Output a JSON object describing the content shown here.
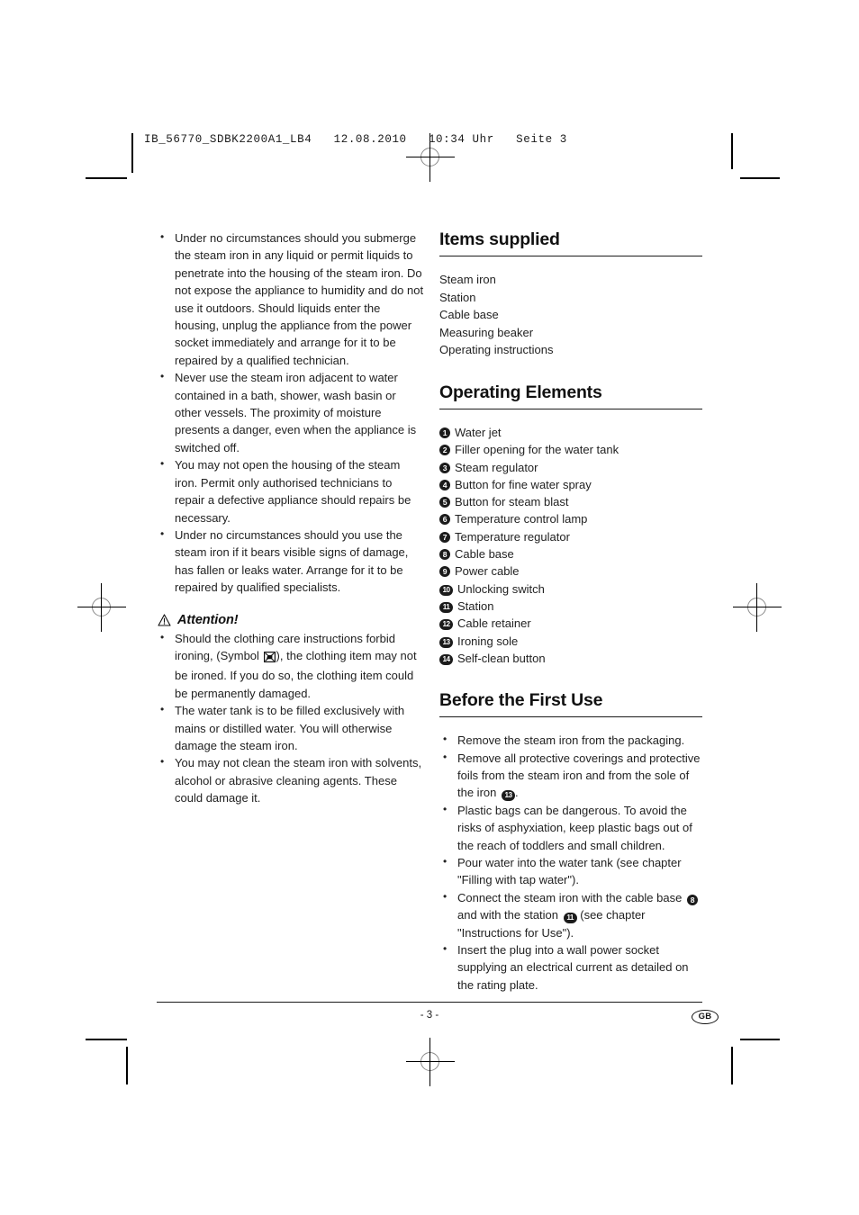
{
  "header": {
    "line": "IB_56770_SDBK2200A1_LB4   12.08.2010   10:34 Uhr   Seite 3"
  },
  "left_column": {
    "safety_bullets": [
      "Under no circumstances should you submerge the steam iron in any liquid or permit liquids to penetrate into the housing of the steam iron. Do not expose the appliance to humidity and do not use it outdoors. Should liquids enter the housing, unplug the appliance from the power socket immediately and arrange for it to be repaired by a qualified technician.",
      "Never use the steam iron adjacent to water contained in a bath, shower, wash basin or other vessels. The proximity of moisture presents a danger, even when the appliance is switched off.",
      "You may not open the housing of the steam iron. Permit only authorised technicians to repair a defective appliance should repairs be necessary.",
      "Under no circumstances should you use the steam iron if it bears visible signs of damage, has fallen or leaks water. Arrange for it to be repaired by qualified specialists."
    ],
    "attention": {
      "icon": "warning-triangle-icon",
      "title": "Attention!",
      "bullet_1_part_1": "Should the clothing care instructions  forbid ironing, (Symbol ",
      "bullet_1_symbol": "do-not-iron-icon",
      "bullet_1_part_2": "), the clothing item may not be ironed. If you do so, the clothing item could be permanently damaged.",
      "bullets": [
        "The water tank is to be filled exclusively with mains or distilled water. You will otherwise damage the steam iron.",
        "You may not clean the steam iron with solvents, alcohol or abrasive cleaning agents. These could damage it."
      ]
    }
  },
  "right_column": {
    "items_supplied": {
      "heading": "Items supplied",
      "items": [
        "Steam iron",
        "Station",
        "Cable base",
        "Measuring beaker",
        "Operating instructions"
      ]
    },
    "operating_elements": {
      "heading": "Operating Elements",
      "items": [
        {
          "num": "1",
          "label": "Water jet"
        },
        {
          "num": "2",
          "label": "Filler opening for the water tank"
        },
        {
          "num": "3",
          "label": "Steam regulator"
        },
        {
          "num": "4",
          "label": "Button for fine water spray"
        },
        {
          "num": "5",
          "label": "Button for steam blast"
        },
        {
          "num": "6",
          "label": "Temperature control lamp"
        },
        {
          "num": "7",
          "label": "Temperature regulator"
        },
        {
          "num": "8",
          "label": "Cable base"
        },
        {
          "num": "9",
          "label": "Power cable"
        },
        {
          "num": "10",
          "label": "Unlocking switch"
        },
        {
          "num": "11",
          "label": "Station"
        },
        {
          "num": "12",
          "label": "Cable retainer"
        },
        {
          "num": "13",
          "label": "Ironing sole"
        },
        {
          "num": "14",
          "label": "Self-clean button"
        }
      ]
    },
    "before_first_use": {
      "heading": "Before the First Use",
      "bullet_1": "Remove the steam iron from the packaging.",
      "bullet_2_part_1": "Remove all protective coverings and protective foils from the steam iron and from the sole of the iron ",
      "bullet_2_ref": "13",
      "bullet_2_part_2": ".",
      "bullet_3": "Plastic bags can be dangerous. To avoid the risks of asphyxiation, keep plastic bags out of the reach of toddlers and small children.",
      "bullet_4": "Pour water into the water tank (see chapter \"Filling with tap water\").",
      "bullet_5_part_1": "Connect the steam iron with the cable base ",
      "bullet_5_ref_1": "8",
      "bullet_5_part_2": " and with the station ",
      "bullet_5_ref_2": "11",
      "bullet_5_part_3": " (see chapter \"Instructions for Use\").",
      "bullet_6": "Insert the plug into a wall power socket supplying an electrical current as detailed on the rating plate."
    }
  },
  "footer": {
    "page_number": "- 3 -",
    "language_badge": "GB"
  }
}
